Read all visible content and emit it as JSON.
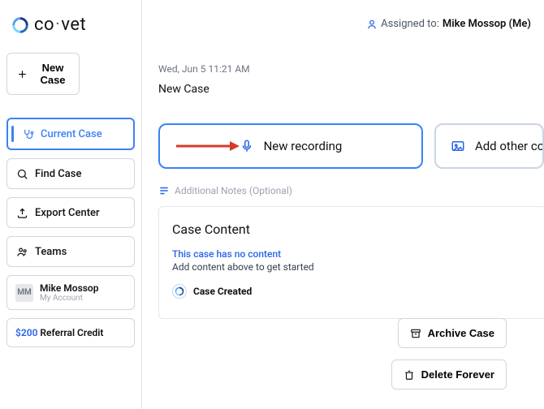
{
  "logo": {
    "brand_a": "co",
    "brand_b": "vet"
  },
  "sidebar": {
    "new_case": "New Case",
    "items": [
      {
        "label": "Current Case"
      },
      {
        "label": "Find Case"
      },
      {
        "label": "Export Center"
      },
      {
        "label": "Teams"
      }
    ],
    "user": {
      "initials": "MM",
      "name": "Mike Mossop",
      "subtitle": "My Account"
    },
    "referral": {
      "amount": "$200",
      "label": "Referral Credit"
    }
  },
  "header": {
    "assigned_prefix": "Assigned to:",
    "assigned_value": "Mike Mossop (Me)"
  },
  "case": {
    "timestamp": "Wed, Jun 5 11:21 AM",
    "title": "New Case"
  },
  "actions": {
    "new_recording": "New recording",
    "add_other": "Add other content"
  },
  "notes": {
    "label": "Additional Notes (Optional)"
  },
  "content_panel": {
    "title": "Case Content",
    "no_content": "This case has no content",
    "hint": "Add content above to get started",
    "created": "Case Created"
  },
  "footer": {
    "archive": "Archive Case",
    "delete": "Delete Forever"
  }
}
